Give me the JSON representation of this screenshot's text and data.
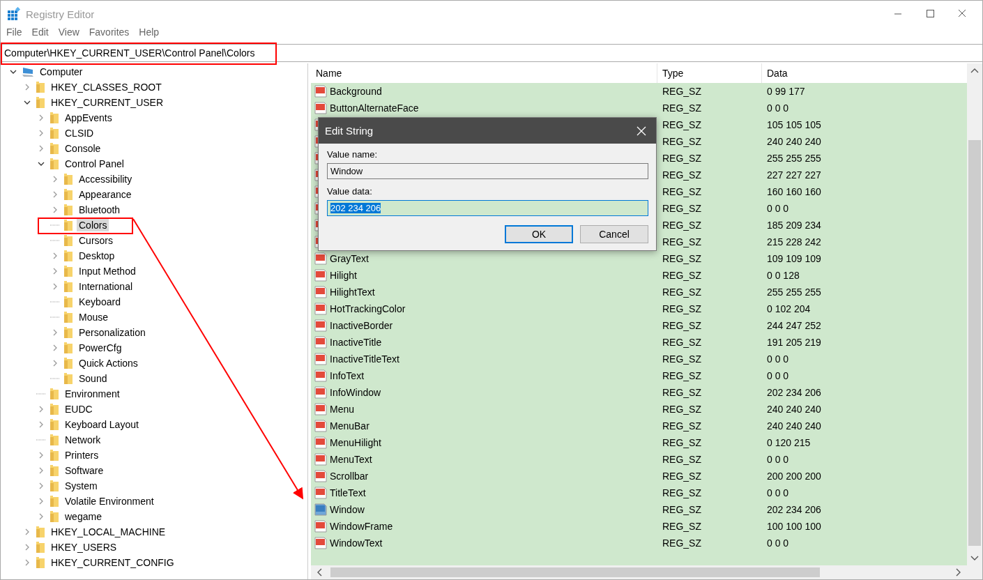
{
  "window": {
    "title": "Registry Editor"
  },
  "menu": [
    "File",
    "Edit",
    "View",
    "Favorites",
    "Help"
  ],
  "address": "Computer\\HKEY_CURRENT_USER\\Control Panel\\Colors",
  "tree": [
    {
      "label": "Computer",
      "kind": "branch",
      "expanded": true,
      "selected": false,
      "children": [
        {
          "label": "HKEY_CLASSES_ROOT",
          "kind": "branch",
          "expanded": false,
          "selected": false
        },
        {
          "label": "HKEY_CURRENT_USER",
          "kind": "branch",
          "expanded": true,
          "selected": false,
          "children": [
            {
              "label": "AppEvents",
              "kind": "branch",
              "expanded": false,
              "selected": false
            },
            {
              "label": "CLSID",
              "kind": "branch",
              "expanded": false,
              "selected": false
            },
            {
              "label": "Console",
              "kind": "branch",
              "expanded": false,
              "selected": false
            },
            {
              "label": "Control Panel",
              "kind": "branch",
              "expanded": true,
              "selected": false,
              "children": [
                {
                  "label": "Accessibility",
                  "kind": "branch",
                  "expanded": false,
                  "selected": false
                },
                {
                  "label": "Appearance",
                  "kind": "branch",
                  "expanded": false,
                  "selected": false
                },
                {
                  "label": "Bluetooth",
                  "kind": "branch",
                  "expanded": false,
                  "selected": false
                },
                {
                  "label": "Colors",
                  "kind": "leaf",
                  "selected": true
                },
                {
                  "label": "Cursors",
                  "kind": "leaf",
                  "selected": false
                },
                {
                  "label": "Desktop",
                  "kind": "branch",
                  "expanded": false,
                  "selected": false
                },
                {
                  "label": "Input Method",
                  "kind": "branch",
                  "expanded": false,
                  "selected": false
                },
                {
                  "label": "International",
                  "kind": "branch",
                  "expanded": false,
                  "selected": false
                },
                {
                  "label": "Keyboard",
                  "kind": "leaf",
                  "selected": false
                },
                {
                  "label": "Mouse",
                  "kind": "leaf",
                  "selected": false
                },
                {
                  "label": "Personalization",
                  "kind": "branch",
                  "expanded": false,
                  "selected": false
                },
                {
                  "label": "PowerCfg",
                  "kind": "branch",
                  "expanded": false,
                  "selected": false
                },
                {
                  "label": "Quick Actions",
                  "kind": "branch",
                  "expanded": false,
                  "selected": false
                },
                {
                  "label": "Sound",
                  "kind": "leaf",
                  "selected": false
                }
              ]
            },
            {
              "label": "Environment",
              "kind": "leaf",
              "selected": false
            },
            {
              "label": "EUDC",
              "kind": "branch",
              "expanded": false,
              "selected": false
            },
            {
              "label": "Keyboard Layout",
              "kind": "branch",
              "expanded": false,
              "selected": false
            },
            {
              "label": "Network",
              "kind": "leaf",
              "selected": false
            },
            {
              "label": "Printers",
              "kind": "branch",
              "expanded": false,
              "selected": false
            },
            {
              "label": "Software",
              "kind": "branch",
              "expanded": false,
              "selected": false
            },
            {
              "label": "System",
              "kind": "branch",
              "expanded": false,
              "selected": false
            },
            {
              "label": "Volatile Environment",
              "kind": "branch",
              "expanded": false,
              "selected": false
            },
            {
              "label": "wegame",
              "kind": "branch",
              "expanded": false,
              "selected": false
            }
          ]
        },
        {
          "label": "HKEY_LOCAL_MACHINE",
          "kind": "branch",
          "expanded": false,
          "selected": false
        },
        {
          "label": "HKEY_USERS",
          "kind": "branch",
          "expanded": false,
          "selected": false
        },
        {
          "label": "HKEY_CURRENT_CONFIG",
          "kind": "branch",
          "expanded": false,
          "selected": false
        }
      ]
    }
  ],
  "table": {
    "columns": [
      "Name",
      "Type",
      "Data"
    ],
    "rows": [
      {
        "name": "Background",
        "type": "REG_SZ",
        "data": "0 99 177",
        "selected": false
      },
      {
        "name": "ButtonAlternateFace",
        "type": "REG_SZ",
        "data": "0 0 0",
        "selected": false
      },
      {
        "type": "REG_SZ",
        "data": "105 105 105",
        "selected": false
      },
      {
        "type": "REG_SZ",
        "data": "240 240 240",
        "selected": false
      },
      {
        "type": "REG_SZ",
        "data": "255 255 255",
        "selected": false
      },
      {
        "type": "REG_SZ",
        "data": "227 227 227",
        "selected": false
      },
      {
        "type": "REG_SZ",
        "data": "160 160 160",
        "selected": false
      },
      {
        "type": "REG_SZ",
        "data": "0 0 0",
        "selected": false
      },
      {
        "type": "REG_SZ",
        "data": "185 209 234",
        "selected": false
      },
      {
        "type": "REG_SZ",
        "data": "215 228 242",
        "selected": false
      },
      {
        "name": "GrayText",
        "type": "REG_SZ",
        "data": "109 109 109",
        "selected": false
      },
      {
        "name": "Hilight",
        "type": "REG_SZ",
        "data": "0 0 128",
        "selected": false
      },
      {
        "name": "HilightText",
        "type": "REG_SZ",
        "data": "255 255 255",
        "selected": false
      },
      {
        "name": "HotTrackingColor",
        "type": "REG_SZ",
        "data": "0 102 204",
        "selected": false
      },
      {
        "name": "InactiveBorder",
        "type": "REG_SZ",
        "data": "244 247 252",
        "selected": false
      },
      {
        "name": "InactiveTitle",
        "type": "REG_SZ",
        "data": "191 205 219",
        "selected": false
      },
      {
        "name": "InactiveTitleText",
        "type": "REG_SZ",
        "data": "0 0 0",
        "selected": false
      },
      {
        "name": "InfoText",
        "type": "REG_SZ",
        "data": "0 0 0",
        "selected": false
      },
      {
        "name": "InfoWindow",
        "type": "REG_SZ",
        "data": "202 234 206",
        "selected": false
      },
      {
        "name": "Menu",
        "type": "REG_SZ",
        "data": "240 240 240",
        "selected": false
      },
      {
        "name": "MenuBar",
        "type": "REG_SZ",
        "data": "240 240 240",
        "selected": false
      },
      {
        "name": "MenuHilight",
        "type": "REG_SZ",
        "data": "0 120 215",
        "selected": false
      },
      {
        "name": "MenuText",
        "type": "REG_SZ",
        "data": "0 0 0",
        "selected": false
      },
      {
        "name": "Scrollbar",
        "type": "REG_SZ",
        "data": "200 200 200",
        "selected": false
      },
      {
        "name": "TitleText",
        "type": "REG_SZ",
        "data": "0 0 0",
        "selected": false
      },
      {
        "name": "Window",
        "type": "REG_SZ",
        "data": "202 234 206",
        "selected": true
      },
      {
        "name": "WindowFrame",
        "type": "REG_SZ",
        "data": "100 100 100",
        "selected": false
      },
      {
        "name": "WindowText",
        "type": "REG_SZ",
        "data": "0 0 0",
        "selected": false
      }
    ]
  },
  "dialog": {
    "title": "Edit String",
    "name_label": "Value name:",
    "name_value": "Window",
    "data_label": "Value data:",
    "data_value": "202 234 206",
    "buttons": [
      "OK",
      "Cancel"
    ]
  }
}
